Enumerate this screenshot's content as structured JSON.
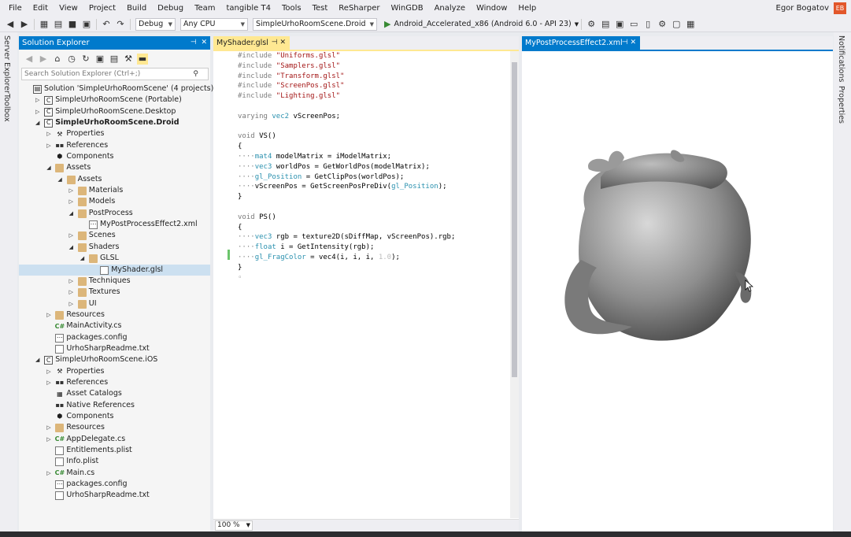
{
  "menu": [
    "File",
    "Edit",
    "View",
    "Project",
    "Build",
    "Debug",
    "Team",
    "tangible T4",
    "Tools",
    "Test",
    "ReSharper",
    "WinGDB",
    "Analyze",
    "Window",
    "Help"
  ],
  "user": {
    "name": "Egor Bogatov",
    "initials": "EB"
  },
  "toolbar": {
    "config": "Debug",
    "platform": "Any CPU",
    "startup_project": "SimpleUrhoRoomScene.Droid",
    "run_target": "Android_Accelerated_x86 (Android 6.0 - API 23)"
  },
  "side_tabs": {
    "left": [
      "Server Explorer",
      "Toolbox"
    ],
    "right": [
      "Notifications",
      "Properties"
    ]
  },
  "solution_explorer": {
    "title": "Solution Explorer",
    "search_placeholder": "Search Solution Explorer (Ctrl+;)",
    "tree": [
      {
        "label": "Solution 'SimpleUrhoRoomScene' (4 projects)",
        "depth": 0,
        "icon": "solution",
        "toggle": ""
      },
      {
        "label": "SimpleUrhoRoomScene (Portable)",
        "depth": 1,
        "icon": "cs-project",
        "toggle": "▷"
      },
      {
        "label": "SimpleUrhoRoomScene.Desktop",
        "depth": 1,
        "icon": "cs-project",
        "toggle": "▷"
      },
      {
        "label": "SimpleUrhoRoomScene.Droid",
        "depth": 1,
        "icon": "cs-project",
        "toggle": "◢",
        "bold": true
      },
      {
        "label": "Properties",
        "depth": 2,
        "icon": "wrench",
        "toggle": "▷"
      },
      {
        "label": "References",
        "depth": 2,
        "icon": "references",
        "toggle": "▷"
      },
      {
        "label": "Components",
        "depth": 2,
        "icon": "components",
        "toggle": ""
      },
      {
        "label": "Assets",
        "depth": 2,
        "icon": "folder",
        "toggle": "◢"
      },
      {
        "label": "Assets",
        "depth": 3,
        "icon": "folder",
        "toggle": "◢"
      },
      {
        "label": "Materials",
        "depth": 4,
        "icon": "folder",
        "toggle": "▷"
      },
      {
        "label": "Models",
        "depth": 4,
        "icon": "folder",
        "toggle": "▷"
      },
      {
        "label": "PostProcess",
        "depth": 4,
        "icon": "folder",
        "toggle": "◢"
      },
      {
        "label": "MyPostProcessEffect2.xml",
        "depth": 5,
        "icon": "xml-file",
        "toggle": ""
      },
      {
        "label": "Scenes",
        "depth": 4,
        "icon": "folder",
        "toggle": "▷"
      },
      {
        "label": "Shaders",
        "depth": 4,
        "icon": "folder",
        "toggle": "◢"
      },
      {
        "label": "GLSL",
        "depth": 5,
        "icon": "folder",
        "toggle": "◢"
      },
      {
        "label": "MyShader.glsl",
        "depth": 6,
        "icon": "file",
        "toggle": "",
        "selected": true
      },
      {
        "label": "Techniques",
        "depth": 4,
        "icon": "folder",
        "toggle": "▷"
      },
      {
        "label": "Textures",
        "depth": 4,
        "icon": "folder",
        "toggle": "▷"
      },
      {
        "label": "UI",
        "depth": 4,
        "icon": "folder",
        "toggle": "▷"
      },
      {
        "label": "Resources",
        "depth": 2,
        "icon": "folder",
        "toggle": "▷"
      },
      {
        "label": "MainActivity.cs",
        "depth": 2,
        "icon": "cs-file",
        "toggle": ""
      },
      {
        "label": "packages.config",
        "depth": 2,
        "icon": "config-file",
        "toggle": ""
      },
      {
        "label": "UrhoSharpReadme.txt",
        "depth": 2,
        "icon": "file",
        "toggle": ""
      },
      {
        "label": "SimpleUrhoRoomScene.iOS",
        "depth": 1,
        "icon": "cs-project",
        "toggle": "◢"
      },
      {
        "label": "Properties",
        "depth": 2,
        "icon": "wrench",
        "toggle": "▷"
      },
      {
        "label": "References",
        "depth": 2,
        "icon": "references",
        "toggle": "▷"
      },
      {
        "label": "Asset Catalogs",
        "depth": 2,
        "icon": "catalog",
        "toggle": ""
      },
      {
        "label": "Native References",
        "depth": 2,
        "icon": "references",
        "toggle": ""
      },
      {
        "label": "Components",
        "depth": 2,
        "icon": "components",
        "toggle": ""
      },
      {
        "label": "Resources",
        "depth": 2,
        "icon": "folder",
        "toggle": "▷"
      },
      {
        "label": "AppDelegate.cs",
        "depth": 2,
        "icon": "cs-file",
        "toggle": "▷"
      },
      {
        "label": "Entitlements.plist",
        "depth": 2,
        "icon": "file",
        "toggle": ""
      },
      {
        "label": "Info.plist",
        "depth": 2,
        "icon": "file",
        "toggle": ""
      },
      {
        "label": "Main.cs",
        "depth": 2,
        "icon": "cs-file",
        "toggle": "▷"
      },
      {
        "label": "packages.config",
        "depth": 2,
        "icon": "config-file",
        "toggle": ""
      },
      {
        "label": "UrhoSharpReadme.txt",
        "depth": 2,
        "icon": "file",
        "toggle": ""
      }
    ]
  },
  "editor": {
    "tab": "MyShader.glsl",
    "zoom": "100 %",
    "lines": [
      [
        [
          "pp",
          "#include "
        ],
        [
          "str",
          "\"Uniforms.glsl\""
        ]
      ],
      [
        [
          "pp",
          "#include "
        ],
        [
          "str",
          "\"Samplers.glsl\""
        ]
      ],
      [
        [
          "pp",
          "#include "
        ],
        [
          "str",
          "\"Transform.glsl\""
        ]
      ],
      [
        [
          "pp",
          "#include "
        ],
        [
          "str",
          "\"ScreenPos.glsl\""
        ]
      ],
      [
        [
          "pp",
          "#include "
        ],
        [
          "str",
          "\"Lighting.glsl\""
        ]
      ],
      [],
      [
        [
          "kw",
          "varying "
        ],
        [
          "typ",
          "vec2"
        ],
        [
          "fn",
          " vScreenPos;"
        ]
      ],
      [],
      [
        [
          "kw",
          "void "
        ],
        [
          "fn",
          "VS()"
        ]
      ],
      [
        [
          "fn",
          "{"
        ]
      ],
      [
        [
          "pp",
          "····"
        ],
        [
          "typ",
          "mat4"
        ],
        [
          "fn",
          " modelMatrix = iModelMatrix;"
        ]
      ],
      [
        [
          "pp",
          "····"
        ],
        [
          "typ",
          "vec3"
        ],
        [
          "fn",
          " worldPos = GetWorldPos(modelMatrix);"
        ]
      ],
      [
        [
          "pp",
          "····"
        ],
        [
          "typ",
          "gl_Position"
        ],
        [
          "fn",
          " = GetClipPos(worldPos);"
        ]
      ],
      [
        [
          "pp",
          "····"
        ],
        [
          "fn",
          "vScreenPos = GetScreenPosPreDiv("
        ],
        [
          "typ",
          "gl_Position"
        ],
        [
          "fn",
          ");"
        ]
      ],
      [
        [
          "fn",
          "}"
        ]
      ],
      [],
      [
        [
          "kw",
          "void "
        ],
        [
          "fn",
          "PS()"
        ]
      ],
      [
        [
          "fn",
          "{"
        ]
      ],
      [
        [
          "pp",
          "····"
        ],
        [
          "typ",
          "vec3"
        ],
        [
          "fn",
          " rgb = texture2D(sDiffMap, vScreenPos).rgb;"
        ]
      ],
      [
        [
          "pp",
          "····"
        ],
        [
          "typ",
          "float"
        ],
        [
          "fn",
          " i = GetIntensity(rgb);"
        ]
      ],
      [
        [
          "pp",
          "····"
        ],
        [
          "typ",
          "gl_FragColor"
        ],
        [
          "fn",
          " = vec4(i, i, i, "
        ],
        [
          "num",
          "1.0"
        ],
        [
          "fn",
          ");"
        ]
      ],
      [
        [
          "fn",
          "}"
        ]
      ],
      [
        [
          "pp",
          "◦"
        ]
      ]
    ]
  },
  "preview": {
    "tab": "MyPostProcessEffect2.xml"
  }
}
